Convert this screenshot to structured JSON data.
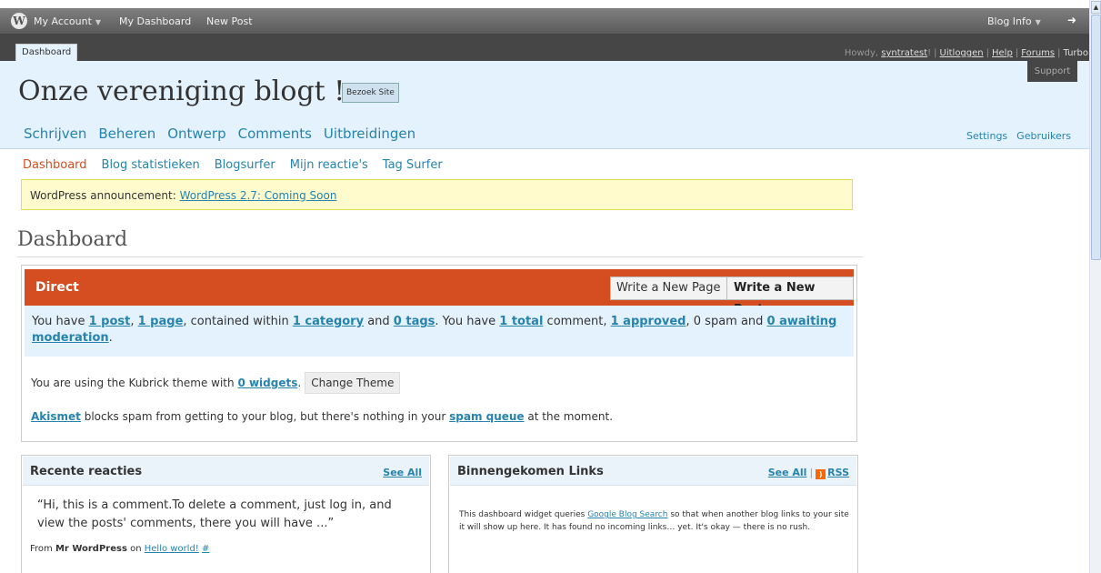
{
  "topbar": {
    "my_account": "My Account",
    "my_dashboard": "My Dashboard",
    "new_post": "New Post",
    "blog_info": "Blog Info"
  },
  "darkstrip": {
    "dashboard_tab": "Dashboard",
    "howdy_prefix": "Howdy,",
    "username": "syntratest",
    "logout": "Uitloggen",
    "help": "Help",
    "forums": "Forums",
    "turbo": "Turbo",
    "support": "Support"
  },
  "header": {
    "site_title": "Onze vereniging blogt !",
    "visit_site": "Bezoek Site",
    "main_nav": [
      "Schrijven",
      "Beheren",
      "Ontwerp",
      "Comments",
      "Uitbreidingen"
    ],
    "right_nav": [
      "Settings",
      "Gebruikers"
    ]
  },
  "sub_nav": [
    "Dashboard",
    "Blog statistieken",
    "Blogsurfer",
    "Mijn reactie's",
    "Tag Surfer"
  ],
  "announcement": {
    "prefix": "WordPress announcement:",
    "link": "WordPress 2.7: Coming Soon"
  },
  "page_title": "Dashboard",
  "direct": {
    "title": "Direct",
    "write_page": "Write a New Page",
    "write_post": "Write a New Post",
    "stats": {
      "t1": "You have ",
      "posts": "1 post",
      "t2": ", ",
      "pages": "1 page",
      "t3": ", contained within ",
      "categories": "1 category",
      "t4": " and ",
      "tags": "0 tags",
      "t5": ". You have ",
      "total": "1 total",
      "t6": " comment, ",
      "approved": "1 approved",
      "t7": ", 0 spam and ",
      "awaiting": "0 awaiting moderation",
      "t8": "."
    },
    "theme": {
      "prefix": "You are using the Kubrick theme with ",
      "widgets": "0 widgets",
      "suffix": ".",
      "change_theme": "Change Theme"
    },
    "akismet": {
      "link": "Akismet",
      "middle": " blocks spam from getting to your blog, but there's nothing in your ",
      "queue": "spam queue",
      "suffix": " at the moment."
    }
  },
  "recent_comments": {
    "title": "Recente reacties",
    "see_all": "See All",
    "text": "“Hi, this is a comment.To delete a comment, just log in, and view the posts' comments, there you will have ...”",
    "from": "From ",
    "author": "Mr WordPress",
    "on": " on ",
    "post": "Hello world!",
    "hash": "#"
  },
  "incoming_links": {
    "title": "Binnengekomen Links",
    "see_all": "See All",
    "rss": "RSS",
    "t1": "This dashboard widget queries ",
    "link": "Google Blog Search",
    "t2": " so that when another blog links to your site it will show up here. It has found no incoming links… yet. It's okay — there is no rush."
  }
}
